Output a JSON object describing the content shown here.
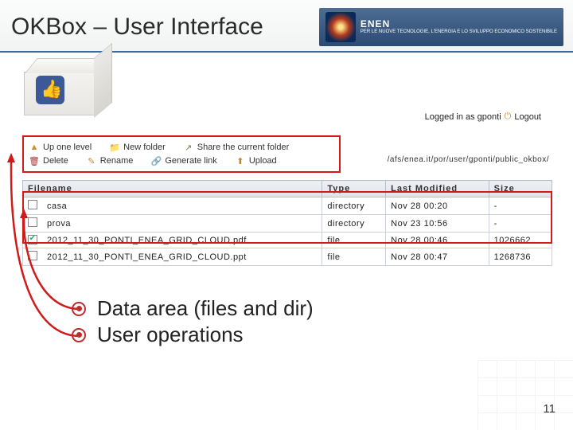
{
  "slide": {
    "title": "OKBox – User Interface",
    "page_number": "11"
  },
  "brand": {
    "name": "ENEN",
    "tagline": "PER LE NUOVE TECNOLOGIE, L'ENERGIA E LO SVILUPPO ECONOMICO SOSTENIBILE"
  },
  "session": {
    "logged_in_text": "Logged in as gponti",
    "logout_label": "Logout"
  },
  "path": "/afs/enea.it/por/user/gponti/public_okbox/",
  "toolbar": {
    "up": "Up one level",
    "new_folder": "New folder",
    "share": "Share the current folder",
    "delete": "Delete",
    "rename": "Rename",
    "generate_link": "Generate link",
    "upload": "Upload"
  },
  "table": {
    "headers": {
      "filename": "Filename",
      "type": "Type",
      "modified": "Last Modified",
      "size": "Size"
    },
    "rows": [
      {
        "checked": false,
        "name": "casa",
        "type": "directory",
        "modified": "Nov 28 00:20",
        "size": "-"
      },
      {
        "checked": false,
        "name": "prova",
        "type": "directory",
        "modified": "Nov 23 10:56",
        "size": "-"
      },
      {
        "checked": true,
        "name": "2012_11_30_PONTI_ENEA_GRID_CLOUD.pdf",
        "type": "file",
        "modified": "Nov 28 00:46",
        "size": "1026662"
      },
      {
        "checked": false,
        "name": "2012_11_30_PONTI_ENEA_GRID_CLOUD.ppt",
        "type": "file",
        "modified": "Nov 28 00:47",
        "size": "1268736"
      }
    ]
  },
  "bullets": {
    "b1": "Data area (files and dir)",
    "b2": "User operations"
  }
}
